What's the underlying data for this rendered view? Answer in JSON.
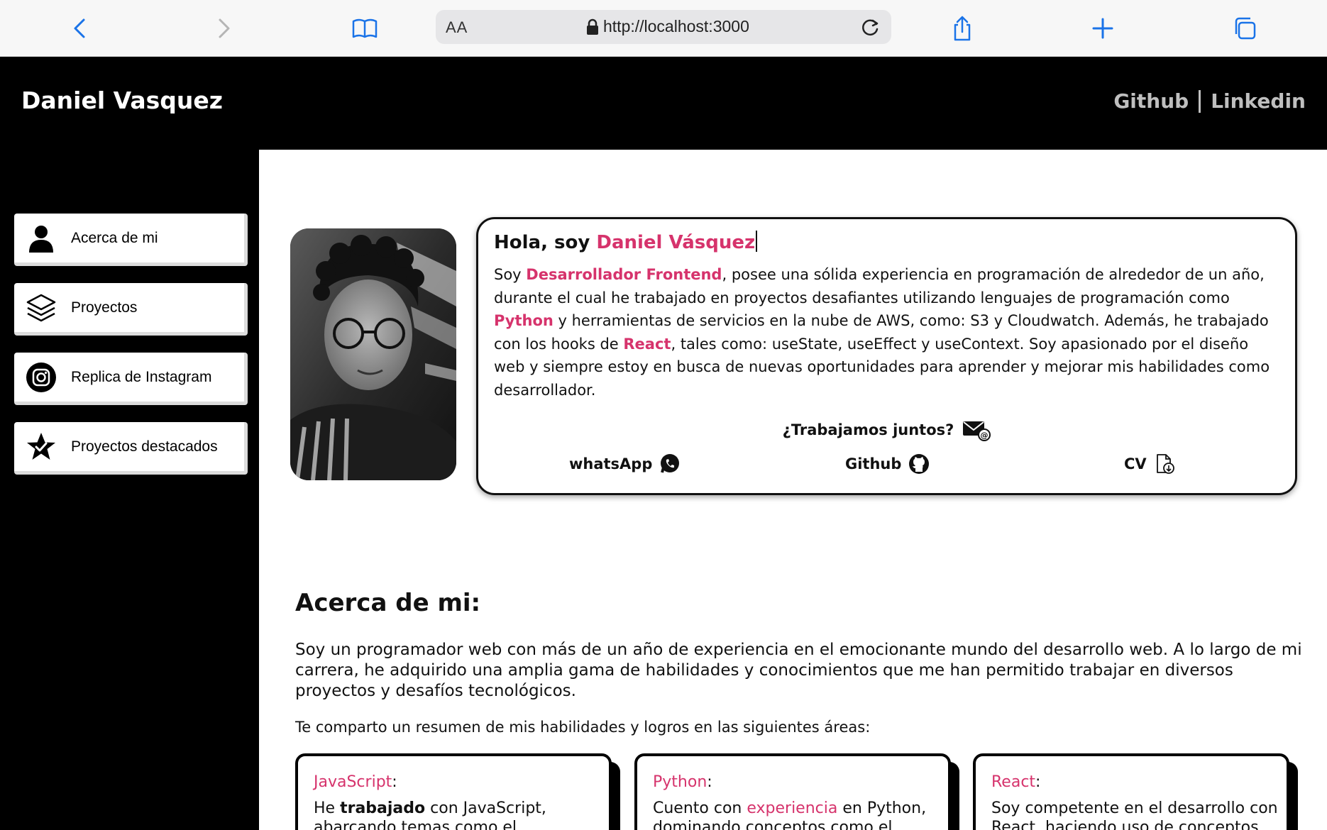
{
  "browser": {
    "aa_label": "AA",
    "url": "http://localhost:3000"
  },
  "header": {
    "brand": "Daniel Vasquez",
    "links": [
      "Github",
      "Linkedin"
    ]
  },
  "sidebar": {
    "items": [
      {
        "label": "Acerca de mi",
        "icon": "user-icon"
      },
      {
        "label": "Proyectos",
        "icon": "layers-icon"
      },
      {
        "label": "Replica de Instagram",
        "icon": "instagram-icon"
      },
      {
        "label": "Proyectos destacados",
        "icon": "star-badge-icon"
      }
    ]
  },
  "intro": {
    "greeting": "Hola, soy ",
    "name": "Daniel Vásquez",
    "t1": "Soy ",
    "h1": "Desarrollador Frontend",
    "t2": ", posee una sólida experiencia en programación de alrededor de un año, durante el cual he trabajado en proyectos desafiantes utilizando lenguajes de programación como ",
    "h2": "Python",
    "t3": " y herramientas de servicios en la nube de AWS, como: S3 y Cloudwatch. Además, he trabajado con los hooks de ",
    "h3": "React",
    "t4": ", tales como: useState, useEffect y useContext. Soy apasionado por el diseño web y siempre estoy en busca de nuevas oportunidades para aprender y mejorar mis habilidades como desarrollador.",
    "work_together": "¿Trabajamos juntos?",
    "contacts": {
      "whatsapp": "whatsApp",
      "github": "Github",
      "cv": "CV"
    }
  },
  "about": {
    "title": "Acerca de mi:",
    "p1": "Soy un programador web con más de un año de experiencia en el emocionante mundo del desarrollo web. A lo largo de mi carrera, he adquirido una amplia gama de habilidades y conocimientos que me han permitido trabajar en diversos proyectos y desafíos tecnológicos.",
    "p2": "Te comparto un resumen de mis habilidades y logros en las siguientes áreas:",
    "cards": [
      {
        "title": "JavaScript",
        "colon": ":",
        "b1": "He ",
        "em": "trabajado",
        "b2": " con JavaScript, abarcando temas como el"
      },
      {
        "title": "Python",
        "colon": ":",
        "b1": "Cuento con ",
        "em": "experiencia",
        "b2": " en Python, dominando conceptos como el"
      },
      {
        "title": "React",
        "colon": ":",
        "b1": "Soy competente en el desarrollo con React, haciendo uso de conceptos"
      }
    ]
  },
  "colors": {
    "accent": "#d6336c",
    "ios_blue": "#1a73e8"
  }
}
